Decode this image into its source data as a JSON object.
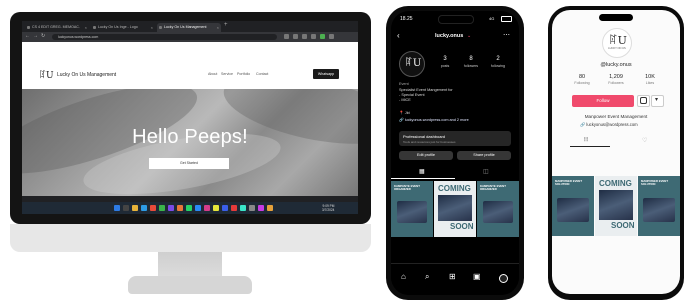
{
  "desktop": {
    "tabs": [
      {
        "label": "CS 4 EDIT GREG. MEMOAC."
      },
      {
        "label": "Lucky On Us Inge - Logo"
      },
      {
        "label": "Lucky On Us Management"
      }
    ],
    "url": "luckyonus.wordpress.com",
    "site": {
      "logo": "ꍏU",
      "brand": "Lucky On Us Management",
      "menu": [
        "About",
        "Service",
        "Portfolio",
        "Contact"
      ],
      "cta": "Whatsapp",
      "hero_title": "Hello Peeps!",
      "hero_button": "Get Started"
    },
    "taskbar_time": "9:09 PM",
    "taskbar_date": "3/7/2024"
  },
  "instagram": {
    "status_time": "18.25",
    "status_signal": "4G",
    "username": "lucky.onus",
    "stats": [
      {
        "value": "3",
        "label": "posts"
      },
      {
        "value": "8",
        "label": "followers"
      },
      {
        "value": "2",
        "label": "following"
      }
    ],
    "category": "Event",
    "bio": [
      "Specialist Event Mangement for",
      "- Special Event",
      "- MICE"
    ],
    "location": "Jkt",
    "link": "luckyonus.wordpress.com and 2 more",
    "dashboard_title": "Professional dashboard",
    "dashboard_sub": "Tools and resources just for businesses",
    "edit_profile": "Edit profile",
    "share_profile": "Share profile",
    "poster_heading": "KAMPANYE EVENT ORGANIZER",
    "poster_coming": "COMING",
    "poster_soon": "SOON"
  },
  "tiktok": {
    "logo": "ꍏU",
    "logo_caption": "LUCKY ON US",
    "username": "@lucky.onus",
    "stats": [
      {
        "value": "80",
        "label": "Following"
      },
      {
        "value": "1,209",
        "label": "Followers"
      },
      {
        "value": "10K",
        "label": "Likes"
      }
    ],
    "follow": "Follow",
    "bio": "Manpower Event Management",
    "link": "luckyonus@wordpress.com",
    "poster_heading": "MANPOWER EVENT SOLUTION",
    "poster_coming": "COMING",
    "poster_soon": "SOON"
  },
  "colors": {
    "brand_pink": "#f04a6c",
    "poster_teal": "#3e6a74",
    "taskbar": "#1f2a36"
  }
}
